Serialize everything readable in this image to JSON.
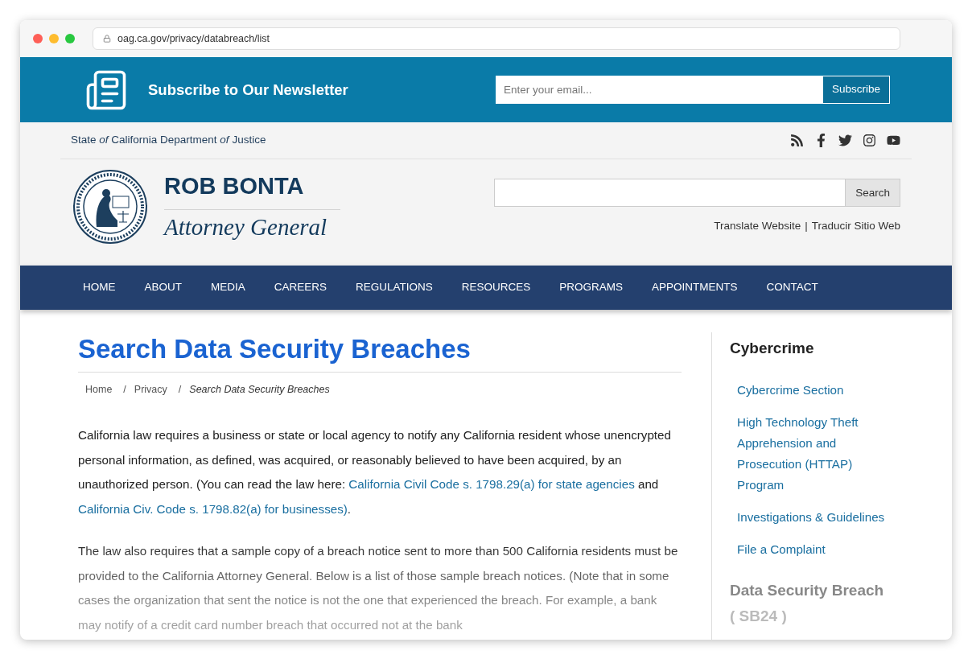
{
  "browser": {
    "url": "oag.ca.gov/privacy/databreach/list"
  },
  "newsletter": {
    "title": "Subscribe to Our Newsletter",
    "placeholder": "Enter your email...",
    "button": "Subscribe"
  },
  "topbar": {
    "agency": "State *of* California Department *of* Justice"
  },
  "brand": {
    "name": "ROB BONTA",
    "title": "Attorney General"
  },
  "search": {
    "button": "Search"
  },
  "translate": {
    "links": [
      "Translate Website",
      "Traducir Sitio Web"
    ],
    "separator": "|"
  },
  "nav": [
    {
      "label": "HOME"
    },
    {
      "label": "ABOUT"
    },
    {
      "label": "MEDIA"
    },
    {
      "label": "CAREERS"
    },
    {
      "label": "REGULATIONS"
    },
    {
      "label": "RESOURCES"
    },
    {
      "label": "PROGRAMS"
    },
    {
      "label": "APPOINTMENTS"
    },
    {
      "label": "CONTACT"
    }
  ],
  "page": {
    "title": "Search Data Security Breaches",
    "breadcrumb_separator": "/",
    "breadcrumb": [
      {
        "label": "Home",
        "current": false
      },
      {
        "label": "Privacy",
        "current": false
      },
      {
        "label": "Search Data Security Breaches",
        "current": true
      }
    ],
    "intro": [
      {
        "kind": "text",
        "text": "California law requires a business or state or local agency to notify any California resident whose unencrypted personal information, as defined, was acquired, or reasonably believed to have been acquired, by an unauthorized person. (You can read the law here: "
      },
      {
        "kind": "link",
        "text": "California Civil Code s. 1798.29(a) for state agencies"
      },
      {
        "kind": "text",
        "text": " and "
      },
      {
        "kind": "link",
        "text": "California Civ. Code s. 1798.82(a) for businesses)"
      },
      {
        "kind": "text",
        "text": "."
      }
    ],
    "notice": "The law also requires that a sample copy of a breach notice sent to more than 500 California residents must be provided to the California Attorney General. Below is a list of those sample breach notices. (Note that in some cases the organization that sent the notice is not the one that experienced the breach. For example, a bank may notify of a credit card number breach that occurred not at the bank"
  },
  "sidebar": {
    "title": "Cybercrime",
    "links": [
      "Cybercrime Section",
      "High Technology Theft Apprehension and Prosecution (HTTAP) Program",
      "Investigations & Guidelines",
      "File a Complaint"
    ],
    "section_title": "Data Security Breach",
    "section_subtitle": "( SB24 )"
  }
}
